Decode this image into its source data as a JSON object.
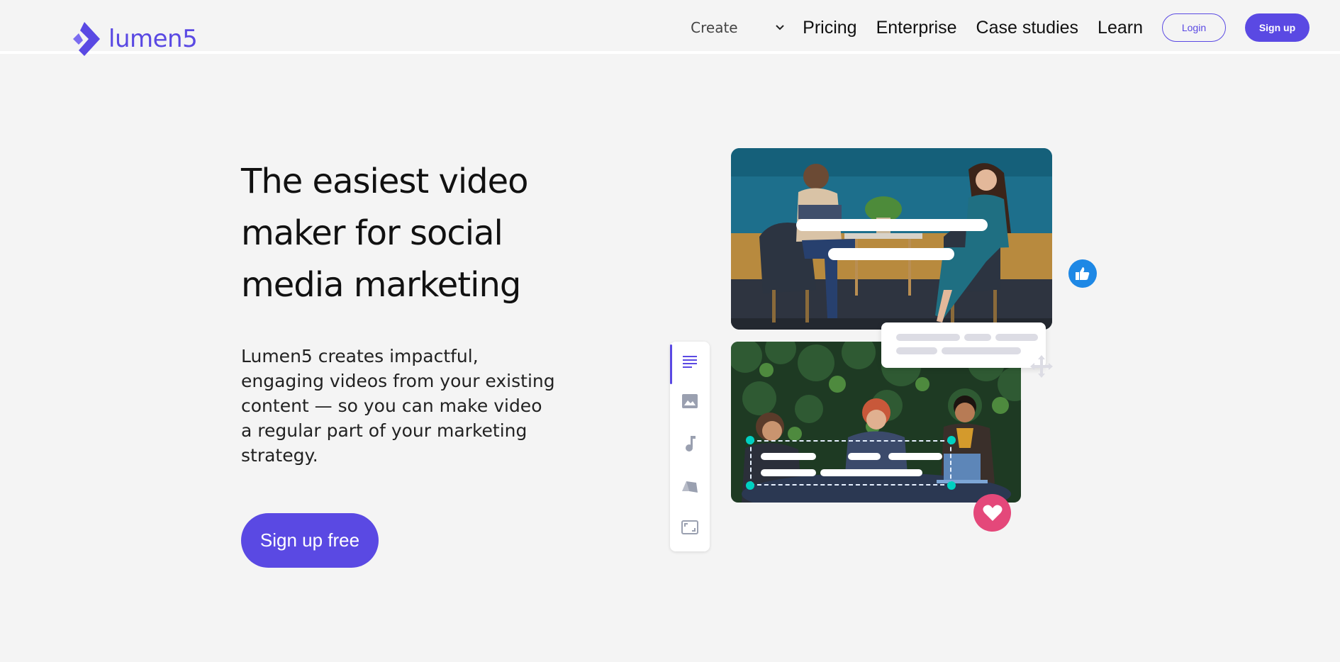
{
  "brand": {
    "name": "lumen5",
    "color": "#5a49e3"
  },
  "nav": {
    "create_label": "Create",
    "links": [
      "Pricing",
      "Enterprise",
      "Case studies",
      "Learn"
    ],
    "login_label": "Login",
    "signup_label": "Sign up"
  },
  "hero": {
    "title": "The easiest video maker for social media marketing",
    "subtitle": "Lumen5 creates impactful, engaging videos from your existing content — so you can make video a regular part of your marketing strategy.",
    "cta_label": "Sign up free"
  },
  "illustration": {
    "toolbar_icons": [
      "text-icon",
      "image-icon",
      "music-icon",
      "style-icon",
      "resize-icon"
    ],
    "reaction_icons": [
      "thumbs-up-icon",
      "heart-icon"
    ],
    "colors": {
      "like": "#1e88e5",
      "heart": "#e4487a",
      "handle": "#00d1c1"
    }
  }
}
